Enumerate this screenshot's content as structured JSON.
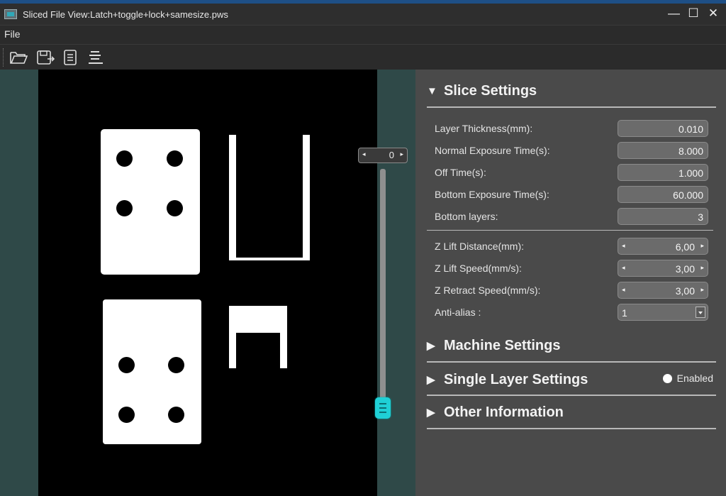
{
  "window": {
    "title": "Sliced File View:Latch+toggle+lock+samesize.pws",
    "controls": {
      "minimize": "—",
      "maximize": "☐",
      "close": "✕"
    }
  },
  "menu": {
    "file": "File"
  },
  "toolbar": {
    "icons": [
      "open-folder-icon",
      "save-icon",
      "document-icon",
      "list-icon"
    ]
  },
  "layer_slider": {
    "value": "0",
    "level": 0
  },
  "slice_settings": {
    "header": "Slice Settings",
    "fields": [
      {
        "label": "Layer Thickness(mm):",
        "value": "0.010"
      },
      {
        "label": "Normal Exposure Time(s):",
        "value": "8.000"
      },
      {
        "label": "Off Time(s):",
        "value": "1.000"
      },
      {
        "label": "Bottom Exposure Time(s):",
        "value": "60.000"
      },
      {
        "label": "Bottom layers:",
        "value": "3"
      }
    ],
    "spin_fields": [
      {
        "label": "Z Lift Distance(mm):",
        "value": "6,00"
      },
      {
        "label": "Z Lift Speed(mm/s):",
        "value": "3,00"
      },
      {
        "label": "Z Retract Speed(mm/s):",
        "value": "3,00"
      }
    ],
    "anti_alias": {
      "label": "Anti-alias :",
      "value": "1"
    }
  },
  "machine_settings": {
    "header": "Machine Settings"
  },
  "single_layer_settings": {
    "header": "Single Layer Settings",
    "enabled_label": "Enabled"
  },
  "other_information": {
    "header": "Other Information"
  }
}
